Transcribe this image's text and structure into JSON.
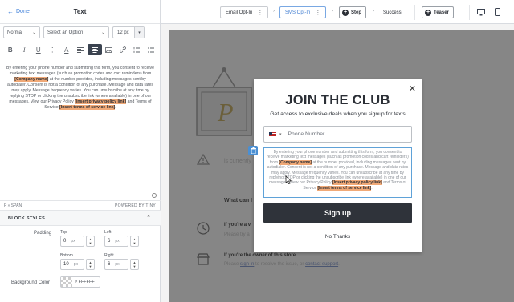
{
  "left_panel": {
    "done_label": "Done",
    "title": "Text",
    "block_type": "Normal",
    "option_placeholder": "Select an Option",
    "font_size": "12 px",
    "editor_text": {
      "p1": "By entering your phone number and submitting this form, you consent to receive marketing text messages (such as promotion codes and cart reminders) from ",
      "company": "[Company name]",
      "p2": " at the number provided, including messages sent by autodialer. Consent is not a condition of any purchase. Message and data rates may apply. Message frequency varies. You can unsubscribe at any time by replying STOP or clicking the unsubscribe link (where available) in one of our messages. View our Privacy Policy ",
      "privacy": "[Insert privacy policy link]",
      "p3": " and Terms of Service ",
      "terms": "[Insert terms of service link]",
      "p4": "."
    },
    "status_path": "P » SPAN",
    "powered_by": "POWERED BY TINY",
    "block_styles": {
      "title": "BLOCK STYLES",
      "padding_label": "Padding",
      "top_label": "Top",
      "left_label": "Left",
      "bottom_label": "Bottom",
      "right_label": "Right",
      "top_value": "0",
      "left_value": "6",
      "bottom_value": "10",
      "right_value": "6",
      "unit": "px",
      "bg_color_label": "Background Color",
      "bg_color_value": "# FFFFFF"
    }
  },
  "topbar": {
    "step_email": "Email Opt-In",
    "step_sms": "SMS Opt-In",
    "add_step": "Step",
    "step_success": "Success",
    "teaser": "Teaser"
  },
  "canvas": {
    "bg_currently": "is currently",
    "bg_what_can": "What can I",
    "bg_if_youre": "If you're a v",
    "bg_please_try": "Please try a",
    "bg_owner": "If you're the owner of this store",
    "bg_please_sign": "Please ",
    "bg_sign_in": "sign in",
    "bg_resolve": " to resolve the issue, or ",
    "bg_contact": "contact support",
    "bg_period": "."
  },
  "modal": {
    "title": "JOIN THE CLUB",
    "subtitle": "Get access to exclusive deals when you signup for texts",
    "phone_placeholder": "Phone Number",
    "disclaimer": {
      "p1": "By entering your phone number and submitting this form, you consent to receive marketing text messages (such as promotion codes and cart reminders) from ",
      "company": "[Company name]",
      "p2": " at the number provided, including messages sent by autodialer. Consent is not a condition of any purchase. Message and data rates may apply. Message frequency varies. You can unsubscribe at any time by replying STOP or clicking the unsubscribe link (where available) in one of our messages. View our Privacy Policy ",
      "privacy": "[Insert privacy policy link]",
      "p3": " and Terms of Service ",
      "terms": "[Insert terms of service link]",
      "p4": "."
    },
    "signup_label": "Sign up",
    "no_thanks": "No Thanks"
  },
  "colors": {
    "accent_blue": "#3d7fd9",
    "highlight": "#f0a977",
    "dark_button": "#2f333a",
    "canvas_gray": "#868686"
  }
}
